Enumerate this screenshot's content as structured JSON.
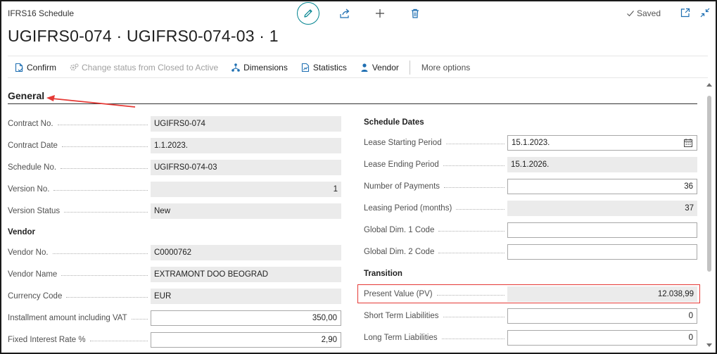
{
  "header": {
    "caption": "IFRS16 Schedule",
    "title": "UGIFRS0-074 · UGIFRS0-074-03 · 1",
    "saved_label": "Saved"
  },
  "icons": {
    "edit": "pencil-icon",
    "share": "share-icon",
    "new": "plus-icon",
    "delete": "trash-icon",
    "open_new_window": "open-in-new-window-icon",
    "collapse": "collapse-icon",
    "calendar": "calendar-icon"
  },
  "actions": {
    "confirm": "Confirm",
    "change_status": "Change status from Closed to Active",
    "dimensions": "Dimensions",
    "statistics": "Statistics",
    "vendor": "Vendor",
    "more": "More options"
  },
  "section": {
    "title": "General"
  },
  "left": {
    "contract_no": {
      "label": "Contract No.",
      "value": "UGIFRS0-074"
    },
    "contract_date": {
      "label": "Contract Date",
      "value": "1.1.2023."
    },
    "schedule_no": {
      "label": "Schedule No.",
      "value": "UGIFRS0-074-03"
    },
    "version_no": {
      "label": "Version No.",
      "value": "1"
    },
    "version_status": {
      "label": "Version Status",
      "value": "New"
    },
    "vendor_group": "Vendor",
    "vendor_no": {
      "label": "Vendor No.",
      "value": "C0000762"
    },
    "vendor_name": {
      "label": "Vendor Name",
      "value": "EXTRAMONT DOO BEOGRAD"
    },
    "currency_code": {
      "label": "Currency Code",
      "value": "EUR"
    },
    "installment": {
      "label": "Installment amount including VAT",
      "value": "350,00"
    },
    "fixed_rate": {
      "label": "Fixed Interest Rate %",
      "value": "2,90"
    }
  },
  "right": {
    "schedule_group": "Schedule Dates",
    "lease_start": {
      "label": "Lease Starting Period",
      "value": "15.1.2023."
    },
    "lease_end": {
      "label": "Lease Ending Period",
      "value": "15.1.2026."
    },
    "num_payments": {
      "label": "Number of Payments",
      "value": "36"
    },
    "leasing_period": {
      "label": "Leasing Period (months)",
      "value": "37"
    },
    "global_dim1": {
      "label": "Global Dim. 1 Code",
      "value": ""
    },
    "global_dim2": {
      "label": "Global Dim. 2 Code",
      "value": ""
    },
    "transition_group": "Transition",
    "present_value": {
      "label": "Present Value (PV)",
      "value": "12.038,99"
    },
    "short_term": {
      "label": "Short Term Liabilities",
      "value": "0"
    },
    "long_term": {
      "label": "Long Term Liabilities",
      "value": "0"
    }
  },
  "colors": {
    "accent": "#00838f",
    "highlight": "#e53935",
    "readonly_bg": "#ebebeb"
  }
}
